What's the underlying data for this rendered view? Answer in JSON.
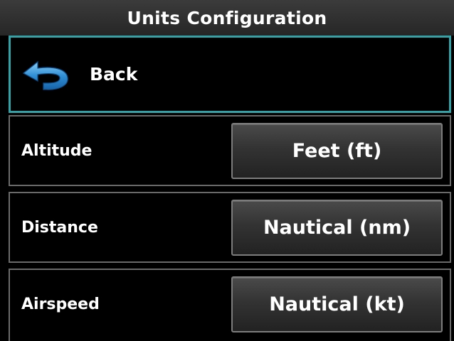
{
  "header": {
    "title": "Units Configuration"
  },
  "back": {
    "label": "Back",
    "icon": "back-arrow-icon",
    "border_color": "#2fa3a8"
  },
  "settings": [
    {
      "label": "Altitude",
      "value": "Feet (ft)"
    },
    {
      "label": "Distance",
      "value": "Nautical (nm)"
    },
    {
      "label": "Airspeed",
      "value": "Nautical (kt)"
    }
  ]
}
